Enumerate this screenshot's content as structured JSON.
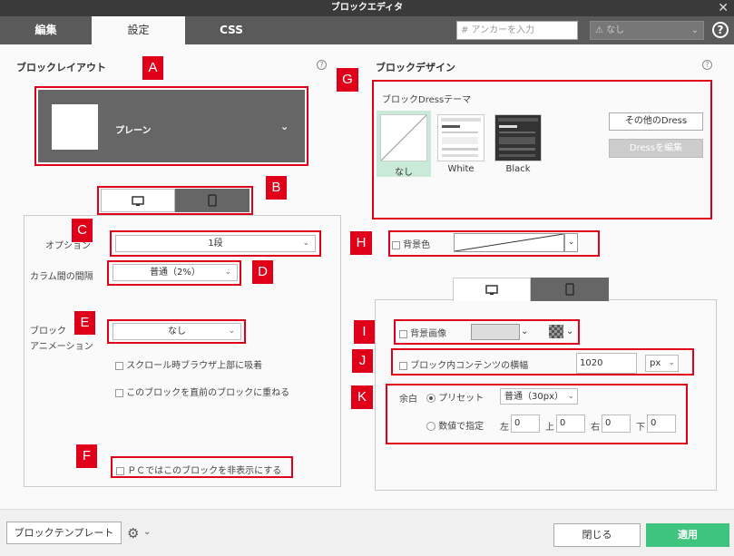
{
  "window": {
    "title": "ブロックエディタ",
    "close": "✕"
  },
  "tabs": [
    {
      "label": "編集"
    },
    {
      "label": "設定"
    },
    {
      "label": "CSS"
    }
  ],
  "anchor": {
    "placeholder": "# アンカーを入力"
  },
  "anchor_select": {
    "value": "なし"
  },
  "help_big": "?",
  "left": {
    "title": "ブロックレイアウト",
    "layout_label": "プレーン",
    "option_label": "オプション",
    "option_value": "1段",
    "gap_label": "カラム間の間隔",
    "gap_value": "普通（2%）",
    "anim_label_1": "ブロック",
    "anim_label_2": "アニメーション",
    "anim_value": "なし",
    "cb_scroll": "スクロール時ブラウザ上部に吸着",
    "cb_overlap": "このブロックを直前のブロックに重ねる",
    "cb_hide_pc": "ＰＣではこのブロックを非表示にする"
  },
  "right": {
    "title": "ブロックデザイン",
    "theme_title": "ブロックDressテーマ",
    "themes": [
      {
        "name": "なし"
      },
      {
        "name": "White"
      },
      {
        "name": "Black"
      }
    ],
    "btn_other": "その他のDress",
    "btn_edit": "Dressを編集",
    "bg_color_label": "背景色",
    "bg_image_label": "背景画像",
    "width_label": "ブロック内コンテンツの横幅",
    "width_value": "1020",
    "width_unit": "px",
    "margin_label": "余白",
    "preset_label": "プリセット",
    "preset_value": "普通（30px）",
    "custom_label": "数値で指定",
    "left_label": "左",
    "left_value": "0",
    "top_label": "上",
    "top_value": "0",
    "right_label": "右",
    "right_value": "0",
    "bottom_label": "下",
    "bottom_value": "0"
  },
  "annotations": [
    "A",
    "B",
    "C",
    "D",
    "E",
    "F",
    "G",
    "H",
    "I",
    "J",
    "K"
  ],
  "footer": {
    "template_btn": "ブロックテンプレート",
    "close_btn": "閉じる",
    "apply_btn": "適用"
  },
  "colors": {
    "annotation_red": "#e0001a",
    "apply_green": "#3fc47f",
    "theme_selected_bg": "#c9ead8"
  }
}
